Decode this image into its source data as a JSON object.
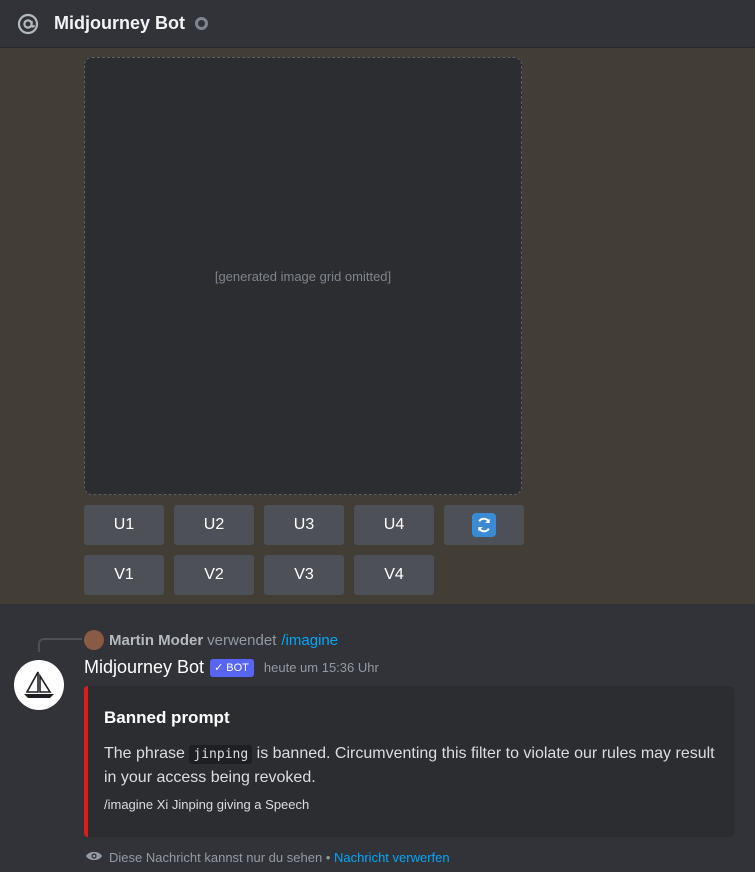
{
  "header": {
    "icon": "at-icon",
    "title": "Midjourney Bot",
    "status_icon": "offline-status-icon"
  },
  "image_grid": {
    "placeholder_text": "[generated image grid omitted]"
  },
  "upscale_buttons": [
    "U1",
    "U2",
    "U3",
    "U4"
  ],
  "variation_buttons": [
    "V1",
    "V2",
    "V3",
    "V4"
  ],
  "reroll_icon": "refresh-icon",
  "reply": {
    "user": "Martin Moder",
    "verb": "verwendet",
    "command": "/imagine"
  },
  "message": {
    "author": "Midjourney Bot",
    "bot_tag": "BOT",
    "timestamp": "heute um 15:36 Uhr"
  },
  "embed": {
    "accent_color": "#e01b1b",
    "title": "Banned prompt",
    "desc_before": "The phrase ",
    "desc_code": "jinping",
    "desc_after": " is banned. Circumventing this filter to violate our rules may result in your access being revoked.",
    "footer": "/imagine Xi Jinping giving a Speech"
  },
  "ephemeral": {
    "icon": "eye-icon",
    "text": "Diese Nachricht kannst nur du sehen",
    "separator": "•",
    "link": "Nachricht verwerfen"
  }
}
